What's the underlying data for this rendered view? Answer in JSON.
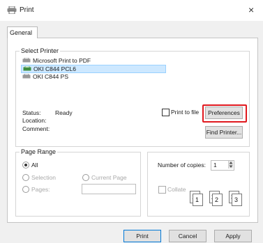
{
  "window": {
    "title": "Print",
    "close_glyph": "×"
  },
  "tabs": [
    {
      "label": "General"
    }
  ],
  "select_printer": {
    "title": "Select Printer",
    "printers": [
      {
        "name": "Microsoft Print to PDF",
        "selected": false,
        "icon": "printer-icon"
      },
      {
        "name": "OKI C844 PCL6",
        "selected": true,
        "icon": "printer-icon"
      },
      {
        "name": "OKI C844 PS",
        "selected": false,
        "icon": "printer-icon"
      }
    ],
    "status_label": "Status:",
    "status_value": "Ready",
    "location_label": "Location:",
    "comment_label": "Comment:",
    "print_to_file_label": "Print to file",
    "preferences_label": "Preferences",
    "find_printer_label": "Find Printer..."
  },
  "page_range": {
    "title": "Page Range",
    "all_label": "All",
    "selection_label": "Selection",
    "current_page_label": "Current Page",
    "pages_label": "Pages:"
  },
  "copies": {
    "number_label": "Number of copies:",
    "value": "1",
    "collate_label": "Collate",
    "collate_icons": [
      "1",
      "1",
      "2",
      "2",
      "3",
      "3"
    ]
  },
  "buttons": {
    "print": "Print",
    "cancel": "Cancel",
    "apply": "Apply"
  },
  "colors": {
    "highlight": "#e0181e",
    "selection": "#cde8ff"
  }
}
